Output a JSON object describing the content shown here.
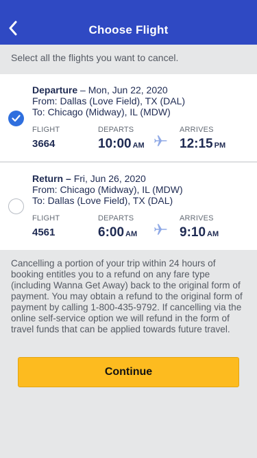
{
  "header": {
    "title": "Choose Flight",
    "background_color": "#2f49c3"
  },
  "instruction": "Select all the flights you want to cancel.",
  "flights": [
    {
      "kind": "Departure",
      "separator": " – ",
      "date": "Mon, Jun 22, 2020",
      "from": "From: Dallas (Love Field), TX (DAL)",
      "to": "To: Chicago (Midway), IL (MDW)",
      "flight_label": "FLIGHT",
      "flight_number": "3664",
      "departs_label": "DEPARTS",
      "departs_time": "10:00",
      "departs_ampm": "AM",
      "arrives_label": "ARRIVES",
      "arrives_time": "12:15",
      "arrives_ampm": "PM",
      "selected": true
    },
    {
      "kind": "Return",
      "separator": " – ",
      "date": "Fri, Jun 26, 2020",
      "from": "From: Chicago (Midway), IL (MDW)",
      "to": "To: Dallas (Love Field), TX (DAL)",
      "flight_label": "FLIGHT",
      "flight_number": "4561",
      "departs_label": "DEPARTS",
      "departs_time": "6:00",
      "departs_ampm": "AM",
      "arrives_label": "ARRIVES",
      "arrives_time": "9:10",
      "arrives_ampm": "AM",
      "selected": false
    }
  ],
  "disclaimer": "Cancelling a portion of your trip within 24 hours of booking entitles you to a refund on any fare type (including Wanna Get Away) back to the original form of payment. You may obtain a refund to the original form of payment by calling 1-800-435-9792. If cancelling via the online self-service option we will refund in the form of travel funds that can be applied towards future travel.",
  "continue_label": "Continue",
  "colors": {
    "accent_blue": "#2f6fde",
    "button_yellow": "#fdbb1f",
    "plane_icon": "#8fa9e6"
  },
  "icons": {
    "back": "chevron-left-icon",
    "check": "checkmark-icon",
    "plane": "airplane-icon"
  }
}
